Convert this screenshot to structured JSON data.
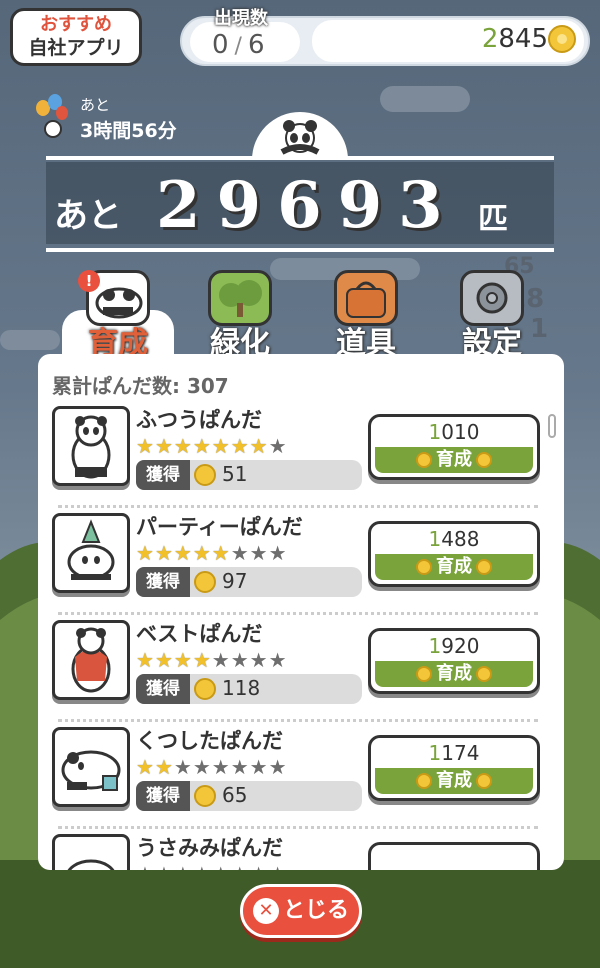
{
  "top": {
    "recommend_line1": "おすすめ",
    "recommend_line2": "自社アプリ",
    "appear_label": "出現数",
    "appear_current": "0",
    "appear_total": "6",
    "coins_prefix": "2",
    "coins_rest": "845"
  },
  "timer": {
    "label": "あと",
    "value": "3時間56分"
  },
  "banner": {
    "prefix": "あと",
    "count": "29693",
    "suffix": "匹"
  },
  "side_numbers": [
    "65",
    "18",
    "1"
  ],
  "tabs": [
    {
      "label": "育成",
      "icon": "panda-icon",
      "active": true
    },
    {
      "label": "緑化",
      "icon": "tree-icon",
      "active": false
    },
    {
      "label": "道具",
      "icon": "bag-icon",
      "active": false
    },
    {
      "label": "設定",
      "icon": "gear-icon",
      "active": false
    }
  ],
  "panel": {
    "total_label": "累計ぱんだ数:",
    "total_value": "307",
    "get_label": "獲得",
    "buy_label": "育成",
    "items": [
      {
        "name": "ふつうぱんだ",
        "stars_on": 7,
        "stars_total": 8,
        "gain": "51",
        "price_first": "1",
        "price_rest": "010"
      },
      {
        "name": "パーティーぱんだ",
        "stars_on": 5,
        "stars_total": 8,
        "gain": "97",
        "price_first": "1",
        "price_rest": "488"
      },
      {
        "name": "ベストぱんだ",
        "stars_on": 4,
        "stars_total": 8,
        "gain": "118",
        "price_first": "1",
        "price_rest": "920"
      },
      {
        "name": "くつしたぱんだ",
        "stars_on": 2,
        "stars_total": 8,
        "gain": "65",
        "price_first": "1",
        "price_rest": "174"
      },
      {
        "name": "うさみみぱんだ",
        "stars_on": 0,
        "stars_total": 8,
        "gain": "",
        "price_first": "",
        "price_rest": ""
      }
    ]
  },
  "close_label": "とじる",
  "colors": {
    "accent_green": "#7aa33b",
    "alert_red": "#e9503e",
    "coin_gold": "#f3c63a"
  }
}
